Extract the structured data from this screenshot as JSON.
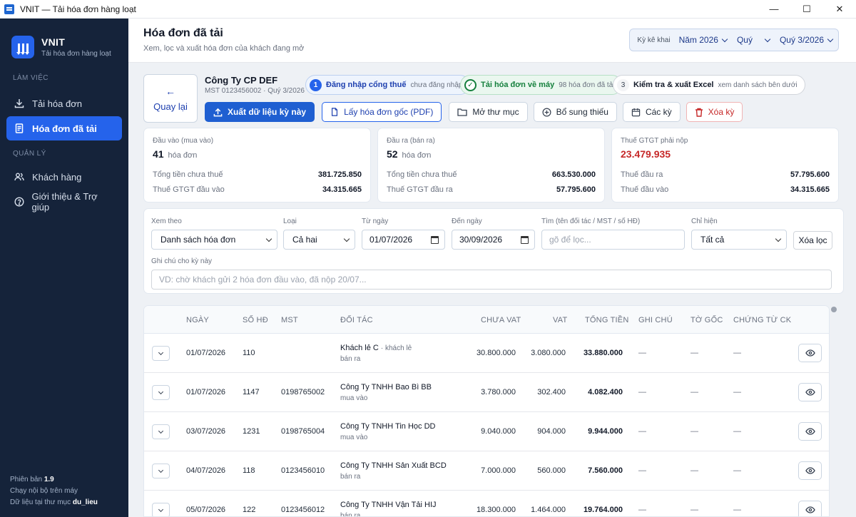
{
  "window": {
    "title": "VNIT — Tải hóa đơn hàng loạt"
  },
  "brand": {
    "name": "VNIT",
    "subtitle": "Tải hóa đơn hàng loạt"
  },
  "sidebar": {
    "section_work": "LÀM VIỆC",
    "section_manage": "QUẢN LÝ",
    "items": [
      {
        "label": "Tải hóa đơn",
        "icon": "download-icon"
      },
      {
        "label": "Hóa đơn đã tải",
        "icon": "document-icon"
      },
      {
        "label": "Khách hàng",
        "icon": "users-icon"
      },
      {
        "label": "Giới thiệu & Trợ giúp",
        "icon": "help-icon"
      }
    ],
    "footer": {
      "version_label": "Phiên bản",
      "version": "1.9",
      "local_note": "Chạy nội bộ trên máy",
      "folder_label": "Dữ liệu tại thư mục",
      "folder": "du_lieu"
    }
  },
  "header": {
    "title": "Hóa đơn đã tải",
    "subtitle": "Xem, lọc và xuất hóa đơn của khách đang mở",
    "period_label": "Kỳ kê khai",
    "year": "Năm 2026",
    "period_type": "Quý",
    "period_value": "Quý 3/2026"
  },
  "company": {
    "back_label": "Quay lại",
    "name": "Công Ty CP DEF",
    "meta": "MST 0123456002 · Quý 3/2026"
  },
  "steps": [
    {
      "num": "1",
      "title": "Đăng nhập cổng thuế",
      "note": "chưa đăng nhập"
    },
    {
      "num": "✓",
      "title": "Tải hóa đơn về máy",
      "note": "98 hóa đơn đã tải"
    },
    {
      "num": "3",
      "title": "Kiểm tra & xuất Excel",
      "note": "xem danh sách bên dưới"
    }
  ],
  "actions": {
    "export": "Xuất dữ liệu kỳ này",
    "original": "Lấy hóa đơn gốc (PDF)",
    "open_folder": "Mở thư mục",
    "supplement": "Bổ sung thiếu",
    "periods": "Các kỳ",
    "delete_period": "Xóa kỳ"
  },
  "stats": {
    "input": {
      "caption": "Đầu vào (mua vào)",
      "count": "41",
      "unit": "hóa đơn",
      "row1_label": "Tổng tiền chưa thuế",
      "row1_value": "381.725.850",
      "row2_label": "Thuế GTGT đầu vào",
      "row2_value": "34.315.665"
    },
    "output": {
      "caption": "Đầu ra (bán ra)",
      "count": "52",
      "unit": "hóa đơn",
      "row1_label": "Tổng tiền chưa thuế",
      "row1_value": "663.530.000",
      "row2_label": "Thuế GTGT đầu ra",
      "row2_value": "57.795.600"
    },
    "vat": {
      "caption": "Thuế GTGT phải nộp",
      "amount": "23.479.935",
      "row1_label": "Thuế đầu ra",
      "row1_value": "57.795.600",
      "row2_label": "Thuế đầu vào",
      "row2_value": "34.315.665"
    }
  },
  "filters": {
    "view_label": "Xem theo",
    "view_value": "Danh sách hóa đơn",
    "type_label": "Loại",
    "type_value": "Cả hai",
    "from_label": "Từ ngày",
    "from_value": "01/07/2026",
    "to_label": "Đến ngày",
    "to_value": "30/09/2026",
    "search_label": "Tìm (tên đối tác / MST / số HĐ)",
    "search_placeholder": "gõ để lọc...",
    "show_label": "Chỉ hiện",
    "show_value": "Tất cả",
    "clear_label": "Xóa lọc",
    "note_label": "Ghi chú cho kỳ này",
    "note_placeholder": "VD: chờ khách gửi 2 hóa đơn đầu vào, đã nộp 20/07..."
  },
  "table": {
    "columns": [
      "NGÀY",
      "SỐ HĐ",
      "MST",
      "ĐỐI TÁC",
      "CHƯA VAT",
      "VAT",
      "TỔNG TIỀN",
      "GHI CHÚ",
      "TỜ GỐC",
      "CHỨNG TỪ CK"
    ],
    "rows": [
      {
        "date": "01/07/2026",
        "no": "110",
        "mst": "",
        "partner": "Khách lẻ C",
        "partner_tag": "· khách lẻ",
        "type": "bán ra",
        "net": "30.800.000",
        "vat": "3.080.000",
        "total": "33.880.000",
        "note": "—",
        "orig": "—",
        "proof": "—"
      },
      {
        "date": "01/07/2026",
        "no": "1147",
        "mst": "0198765002",
        "partner": "Công Ty TNHH Bao Bì BB",
        "partner_tag": "",
        "type": "mua vào",
        "net": "3.780.000",
        "vat": "302.400",
        "total": "4.082.400",
        "note": "—",
        "orig": "—",
        "proof": "—"
      },
      {
        "date": "03/07/2026",
        "no": "1231",
        "mst": "0198765004",
        "partner": "Công Ty TNHH Tin Học DD",
        "partner_tag": "",
        "type": "mua vào",
        "net": "9.040.000",
        "vat": "904.000",
        "total": "9.944.000",
        "note": "—",
        "orig": "—",
        "proof": "—"
      },
      {
        "date": "04/07/2026",
        "no": "118",
        "mst": "0123456010",
        "partner": "Công Ty TNHH Sản Xuất BCD",
        "partner_tag": "",
        "type": "bán ra",
        "net": "7.000.000",
        "vat": "560.000",
        "total": "7.560.000",
        "note": "—",
        "orig": "—",
        "proof": "—"
      },
      {
        "date": "05/07/2026",
        "no": "122",
        "mst": "0123456012",
        "partner": "Công Ty TNHH Vận Tải HIJ",
        "partner_tag": "",
        "type": "bán ra",
        "net": "18.300.000",
        "vat": "1.464.000",
        "total": "19.764.000",
        "note": "—",
        "orig": "—",
        "proof": "—"
      }
    ]
  },
  "colors": {
    "sidebar": "#15233a",
    "accent": "#2563eb",
    "danger": "#c62828",
    "success": "#15803d"
  }
}
